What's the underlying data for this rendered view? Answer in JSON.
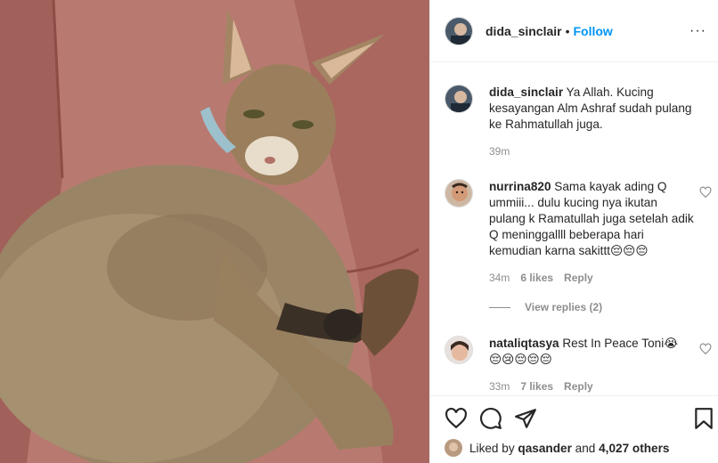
{
  "post": {
    "author": "dida_sinclair",
    "separator": "•",
    "follow_label": "Follow",
    "more_label": "···"
  },
  "caption": {
    "username": "dida_sinclair",
    "text": "Ya Allah. Kucing kesayangan Alm Ashraf sudah pulang ke Rahmatullah juga.",
    "time": "39m"
  },
  "comments": [
    {
      "username": "nurrina820",
      "text": "Sama kayak ading Q ummiii... dulu kucing nya ikutan pulang k Ramatullah juga setelah adik Q meninggallll beberapa hari kemudian karna sakittt😔😔😔",
      "time": "34m",
      "likes": "6 likes",
      "reply": "Reply",
      "view_replies": "View replies (2)"
    },
    {
      "username": "nataliqtasya",
      "text": "Rest In Peace Toni😭 😔😢😔😔😔",
      "time": "33m",
      "likes": "7 likes",
      "reply": "Reply"
    }
  ],
  "likes": {
    "prefix": "Liked by",
    "user": "qasander",
    "and": "and",
    "others": "4,027 others"
  },
  "icons": [
    "heart-icon",
    "comment-icon",
    "share-icon",
    "bookmark-icon",
    "more-icon",
    "small-heart-icon"
  ],
  "colors": {
    "accent": "#0095f6",
    "meta": "#8e8e8e",
    "text": "#262626",
    "border": "#efefef"
  }
}
